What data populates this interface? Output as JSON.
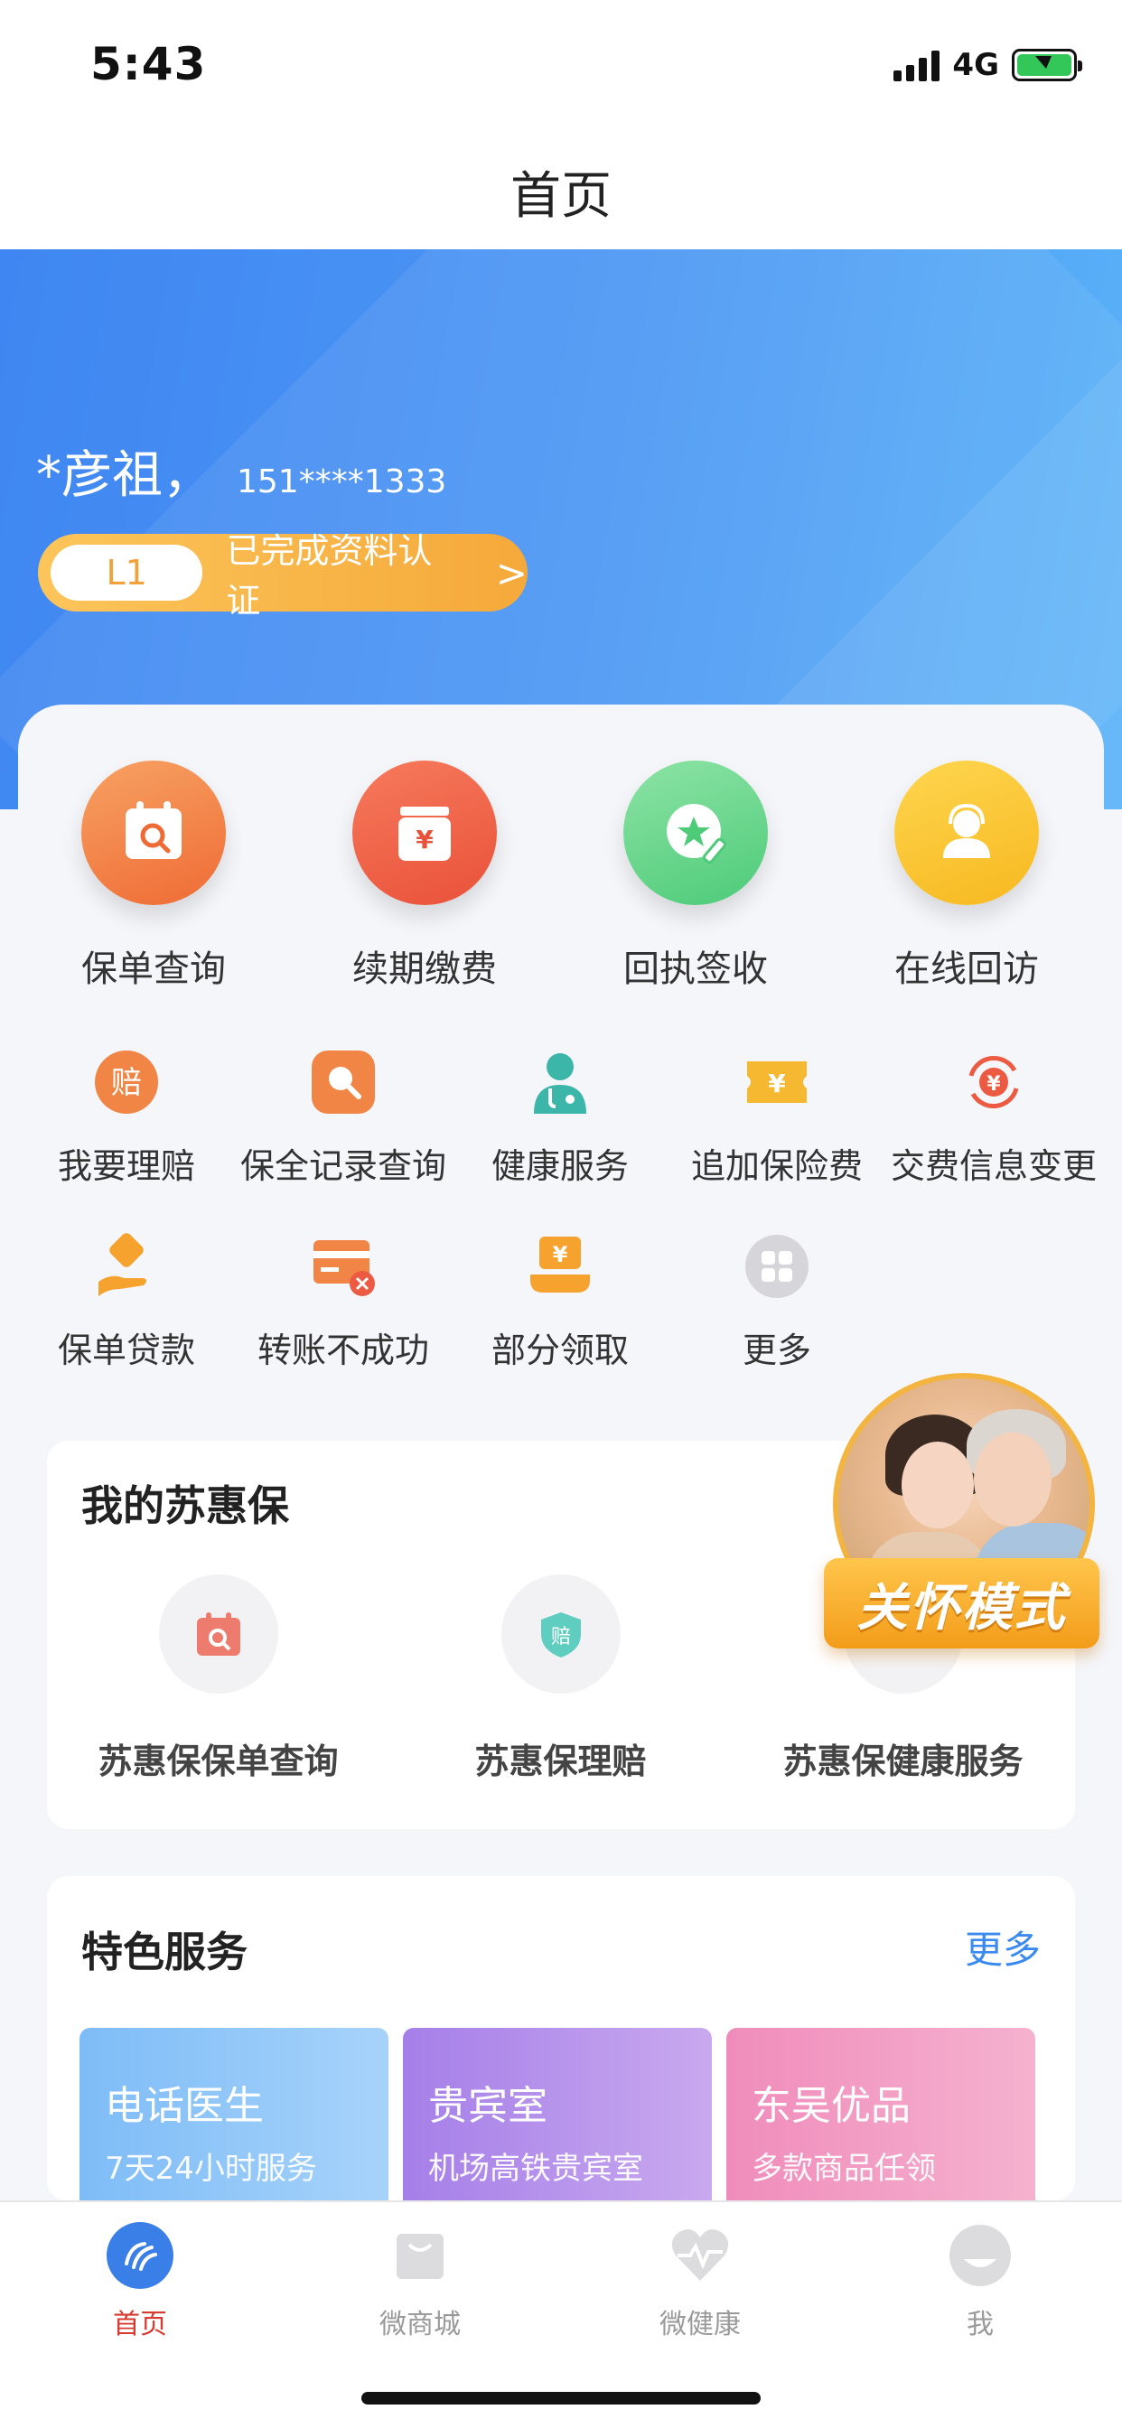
{
  "status": {
    "time": "5:43",
    "network": "4G"
  },
  "nav": {
    "title": "首页"
  },
  "user": {
    "name": "*彦祖，",
    "phone": "151****1333",
    "level": "L1",
    "level_text": "已完成资料认证"
  },
  "main_services": [
    {
      "label": "保单查询",
      "icon": "calendar-search-icon"
    },
    {
      "label": "续期缴费",
      "icon": "yen-bag-icon"
    },
    {
      "label": "回执签收",
      "icon": "star-pen-icon"
    },
    {
      "label": "在线回访",
      "icon": "headset-user-icon"
    }
  ],
  "grid_row1": [
    {
      "label": "我要理赔",
      "icon": "claim-icon"
    },
    {
      "label": "保全记录查询",
      "icon": "search-record-icon"
    },
    {
      "label": "健康服务",
      "icon": "doctor-icon"
    },
    {
      "label": "追加保险费",
      "icon": "ticket-yen-icon"
    },
    {
      "label": "交费信息变更",
      "icon": "refresh-yen-icon"
    }
  ],
  "grid_row2": [
    {
      "label": "保单贷款",
      "icon": "hand-coin-icon"
    },
    {
      "label": "转账不成功",
      "icon": "card-fail-icon"
    },
    {
      "label": "部分领取",
      "icon": "yen-tray-icon"
    },
    {
      "label": "更多",
      "icon": "more-grid-icon"
    }
  ],
  "suhui": {
    "title": "我的苏惠保",
    "items": [
      {
        "label": "苏惠保保单查询",
        "icon": "calendar-search-icon"
      },
      {
        "label": "苏惠保理赔",
        "icon": "shield-claim-icon"
      },
      {
        "label": "苏惠保健康服务",
        "icon": "health-icon"
      }
    ]
  },
  "care_mode": {
    "label": "关怀模式"
  },
  "featured": {
    "title": "特色服务",
    "more": "更多",
    "tiles": [
      {
        "title": "电话医生",
        "sub": "7天24小时服务"
      },
      {
        "title": "贵宾室",
        "sub": "机场高铁贵宾室"
      },
      {
        "title": "东吴优品",
        "sub": "多款商品任领"
      }
    ]
  },
  "tabs": [
    {
      "label": "首页"
    },
    {
      "label": "微商城"
    },
    {
      "label": "微健康"
    },
    {
      "label": "我"
    }
  ],
  "colors": {
    "primary_blue": "#3f86f2",
    "accent_gold": "#f5a93a",
    "tab_active": "#d63a30"
  }
}
